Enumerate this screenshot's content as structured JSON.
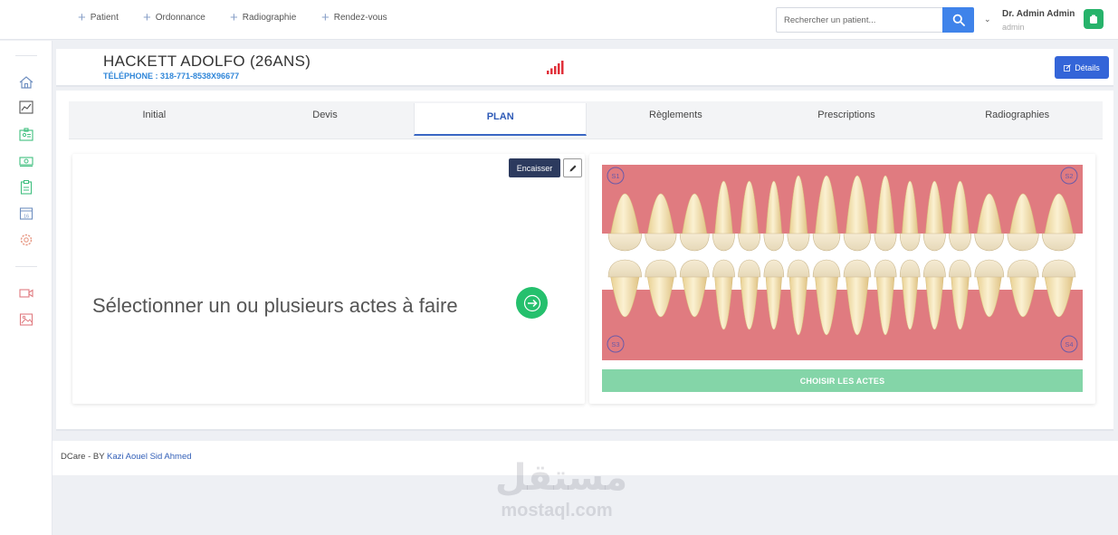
{
  "topbar": {
    "quick_actions": [
      "Patient",
      "Ordonnance",
      "Radiographie",
      "Rendez-vous"
    ],
    "search_placeholder": "Rechercher un patient...",
    "user_name": "Dr. Admin Admin",
    "user_role": "admin"
  },
  "sidebar": {
    "icons": [
      "home-icon",
      "chart-icon",
      "patient-card-icon",
      "cash-icon",
      "clipboard-icon",
      "calendar-icon",
      "settings-icon",
      "video-icon",
      "image-icon"
    ],
    "calendar_day": "16"
  },
  "patient": {
    "name": "HACKETT ADOLFO (26ANS)",
    "phone": "TÉLÉPHONE : 318-771-8538X96677",
    "details_label": "Détails"
  },
  "tabs": [
    {
      "label": "Initial",
      "active": false
    },
    {
      "label": "Devis",
      "active": false
    },
    {
      "label": "PLAN",
      "active": true
    },
    {
      "label": "Règlements",
      "active": false
    },
    {
      "label": "Prescriptions",
      "active": false
    },
    {
      "label": "Radiographies",
      "active": false
    }
  ],
  "plan": {
    "encaisser_label": "Encaisser",
    "select_text": "Sélectionner un ou plusieurs actes à faire",
    "choose_label": "CHOISIR LES ACTES",
    "sectors": [
      "S1",
      "S2",
      "S3",
      "S4"
    ]
  },
  "footer": {
    "prefix": "DCare - BY",
    "author": "Kazi Aouel Sid Ahmed"
  },
  "watermark": {
    "arabic": "مستقل",
    "latin": "mostaql.com"
  },
  "colors": {
    "primary": "#3465d8",
    "success": "#25c06d",
    "gum": "#e07b80",
    "tooth": "#f3e3b8"
  }
}
